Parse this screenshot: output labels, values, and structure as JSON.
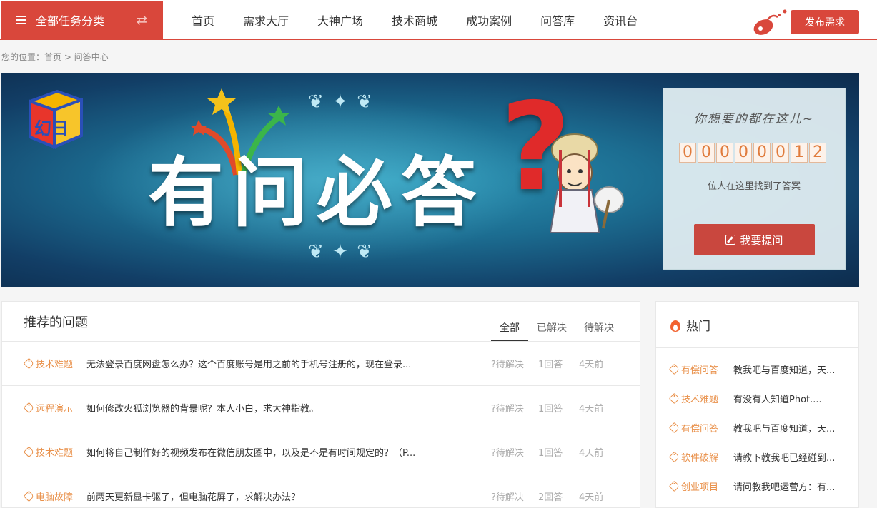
{
  "header": {
    "category_label": "全部任务分类",
    "nav": [
      "首页",
      "需求大厅",
      "大神广场",
      "技术商城",
      "成功案例",
      "问答库",
      "资讯台"
    ],
    "publish_label": "发布需求"
  },
  "breadcrumb": {
    "prefix": "您的位置：",
    "home": "首页",
    "sep": " > ",
    "current": "问答中心"
  },
  "banner": {
    "title": "有问必答",
    "qmark": "?",
    "logo_text": "幻日",
    "slogan": "你想要的都在这儿~",
    "counter": [
      "0",
      "0",
      "0",
      "0",
      "0",
      "0",
      "1",
      "2"
    ],
    "found_text": "位人在这里找到了答案",
    "ask_label": "我要提问"
  },
  "questions": {
    "title": "推荐的问题",
    "tabs": [
      "全部",
      "已解决",
      "待解决"
    ],
    "rows": [
      {
        "tag": "技术难题",
        "text": "无法登录百度网盘怎么办？这个百度账号是用之前的手机号注册的，现在登录...",
        "status": "?待解决",
        "answers": "1回答",
        "time": "4天前"
      },
      {
        "tag": "远程演示",
        "text": "如何修改火狐浏览器的背景呢？本人小白，求大神指教。",
        "status": "?待解决",
        "answers": "1回答",
        "time": "4天前"
      },
      {
        "tag": "技术难题",
        "text": "如何将自己制作好的视频发布在微信朋友圈中，以及是不是有时间规定的？（P...",
        "status": "?待解决",
        "answers": "1回答",
        "time": "4天前"
      },
      {
        "tag": "电脑故障",
        "text": "前两天更新显卡驱了，但电脑花屏了，求解决办法？",
        "status": "?待解决",
        "answers": "2回答",
        "time": "4天前"
      }
    ]
  },
  "hot": {
    "title": "热门",
    "items": [
      {
        "tag": "有偿问答",
        "text": "教我吧与百度知道，天..."
      },
      {
        "tag": "技术难题",
        "text": "有没有人知道Phot...."
      },
      {
        "tag": "有偿问答",
        "text": "教我吧与百度知道，天..."
      },
      {
        "tag": "软件破解",
        "text": "请教下教我吧已经碰到..."
      },
      {
        "tag": "创业项目",
        "text": "请问教我吧运营方：有..."
      }
    ]
  },
  "colors": {
    "brand_red": "#d9473b",
    "tag_orange": "#e9914b",
    "muted": "#aaaaaa"
  }
}
